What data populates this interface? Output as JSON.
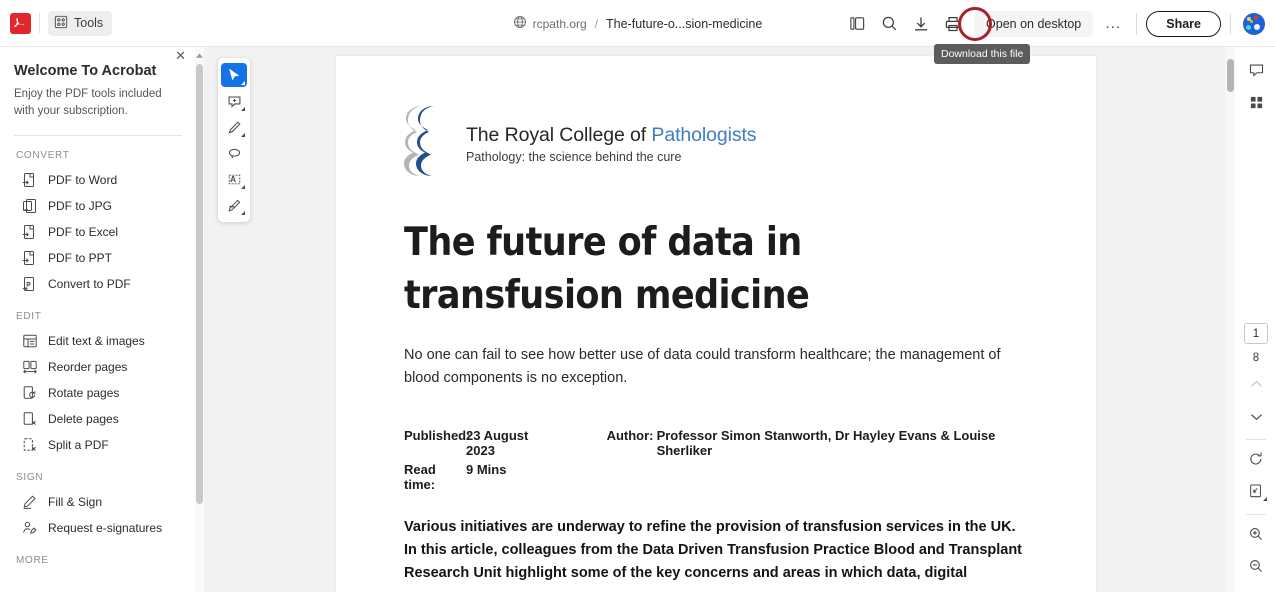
{
  "topbar": {
    "acrobat_logo_icon": "acrobat-logo-icon",
    "tools_label": "Tools",
    "tools_icon": "grid-tools-icon",
    "url": {
      "globe_icon": "globe-icon",
      "domain": "rcpath.org",
      "separator": "/",
      "filename": "The-future-o...sion-medicine"
    },
    "actions": {
      "copy_icon": "copy-pages-icon",
      "search_icon": "search-icon",
      "download_icon": "download-icon",
      "print_icon": "print-icon",
      "open_desktop_label": "Open on desktop",
      "more_label": "...",
      "share_label": "Share",
      "avatar_icon": "user-avatar-icon"
    },
    "tooltip": "Download this file",
    "highlight_color": "#a81f2d"
  },
  "left_panel": {
    "title": "Welcome To Acrobat",
    "subtitle": "Enjoy the PDF tools included with your subscription.",
    "close_icon": "close-icon",
    "sections": [
      {
        "heading": "CONVERT",
        "items": [
          {
            "label": "PDF to Word",
            "icon": "pdf-to-word-icon"
          },
          {
            "label": "PDF to JPG",
            "icon": "pdf-to-jpg-icon"
          },
          {
            "label": "PDF to Excel",
            "icon": "pdf-to-excel-icon"
          },
          {
            "label": "PDF to PPT",
            "icon": "pdf-to-ppt-icon"
          },
          {
            "label": "Convert to PDF",
            "icon": "convert-to-pdf-icon"
          }
        ]
      },
      {
        "heading": "EDIT",
        "items": [
          {
            "label": "Edit text & images",
            "icon": "edit-text-images-icon"
          },
          {
            "label": "Reorder pages",
            "icon": "reorder-pages-icon"
          },
          {
            "label": "Rotate pages",
            "icon": "rotate-pages-icon"
          },
          {
            "label": "Delete pages",
            "icon": "delete-pages-icon"
          },
          {
            "label": "Split a PDF",
            "icon": "split-pdf-icon"
          }
        ]
      },
      {
        "heading": "SIGN",
        "items": [
          {
            "label": "Fill & Sign",
            "icon": "fill-sign-icon"
          },
          {
            "label": "Request e-signatures",
            "icon": "request-esignatures-icon"
          }
        ]
      },
      {
        "heading": "MORE",
        "items": []
      }
    ]
  },
  "tool_palette": {
    "tools": [
      {
        "name": "select-tool",
        "icon": "cursor-arrow-icon",
        "active": true
      },
      {
        "name": "comment-tool",
        "icon": "add-comment-icon",
        "active": false
      },
      {
        "name": "draw-tool",
        "icon": "pencil-draw-icon",
        "active": false
      },
      {
        "name": "lasso-erase-tool",
        "icon": "lasso-icon",
        "active": false
      },
      {
        "name": "text-box-tool",
        "icon": "text-box-icon",
        "active": false
      },
      {
        "name": "signature-tool",
        "icon": "signature-icon",
        "active": false
      }
    ]
  },
  "document": {
    "logo": {
      "org_prefix": "The Royal College of ",
      "org_accent": "Pathologists",
      "tagline": "Pathology: the science behind the cure",
      "accent_color": "#3f7cc2",
      "mark_color": "#1e4f8f"
    },
    "title": "The future of data in transfusion medicine",
    "lede": "No one can fail to see how better use of data could transform healthcare; the management of blood components is no exception.",
    "meta": {
      "published_label": "Published:",
      "published_value": "23 August 2023",
      "author_label": "Author:",
      "author_value": "Professor Simon Stanworth, Dr Hayley Evans & Louise Sherliker",
      "readtime_label": "Read time:",
      "readtime_value": "9 Mins"
    },
    "body_bold": "Various initiatives are underway to refine the provision of transfusion services in the UK. In this article, colleagues from the Data Driven Transfusion Practice Blood and Transplant Research Unit highlight some of the key concerns and areas in which data, digital"
  },
  "right_rail": {
    "comment_icon": "comment-panel-icon",
    "thumbnails_icon": "page-thumbnails-icon",
    "current_page": "1",
    "total_pages": "8",
    "prev_page_icon": "chevron-up-icon",
    "next_page_icon": "chevron-down-icon",
    "rotate_icon": "rotate-clockwise-icon",
    "fit_page_icon": "fit-page-icon",
    "zoom_in_icon": "zoom-in-icon",
    "zoom_out_icon": "zoom-out-icon"
  }
}
